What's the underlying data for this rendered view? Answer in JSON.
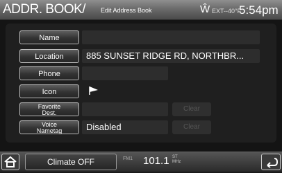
{
  "header": {
    "title": "ADDR. BOOK/",
    "subtitle": "Edit Address Book",
    "compass": "Ŵ",
    "ext_temp": "EXT--40°F",
    "time": "5:54pm"
  },
  "rows": [
    {
      "label": "Name",
      "value": ""
    },
    {
      "label": "Location",
      "value": "885 SUNSET RIDGE RD, NORTHBR..."
    },
    {
      "label": "Phone",
      "value": ""
    },
    {
      "label": "Icon",
      "value": ""
    },
    {
      "label_line1": "Favorite",
      "label_line2": "Dest.",
      "value": "",
      "clear": "Clear"
    },
    {
      "label_line1": "Voice",
      "label_line2": "Nametag",
      "value": "Disabled",
      "clear": "Clear"
    }
  ],
  "footer": {
    "climate": "Climate OFF",
    "preset": "FM1",
    "frequency": "101.1",
    "st": "ST",
    "mhz": "MHz"
  },
  "icons": [
    "home-icon",
    "flag-icon",
    "back-icon",
    "compass-icon"
  ]
}
